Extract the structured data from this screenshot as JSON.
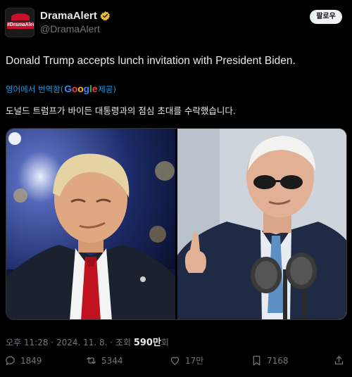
{
  "author": {
    "display_name": "DramaAlert",
    "handle": "@DramaAlert",
    "avatar_text": "#DramaAlert"
  },
  "follow_button": "팔로우",
  "tweet": {
    "text": "Donald Trump accepts lunch invitation with President Biden.",
    "translate_prefix": "영어에서 번역함",
    "translate_brand": "Google",
    "translate_suffix": " 제공)",
    "translate_open": "(",
    "translated_text": "도널드 트럼프가 바이든 대통령과의 점심 초대를 수락했습니다."
  },
  "meta": {
    "time": "오후 11:28",
    "sep1": " · ",
    "date": "2024. 11. 8.",
    "sep2": " · ",
    "views_label": "조회 ",
    "views_value": "590만",
    "views_unit": "회"
  },
  "actions": {
    "replies": "1849",
    "reposts": "5344",
    "likes": "17만",
    "bookmarks": "7168"
  },
  "colors": {
    "background": "#000000",
    "text": "#e7e9ea",
    "muted": "#71767b",
    "link": "#1d9bf0",
    "verified": "#e8b931"
  },
  "icons": [
    "verified-badge-icon",
    "reply-icon",
    "repost-icon",
    "like-icon",
    "bookmark-icon",
    "share-icon"
  ]
}
